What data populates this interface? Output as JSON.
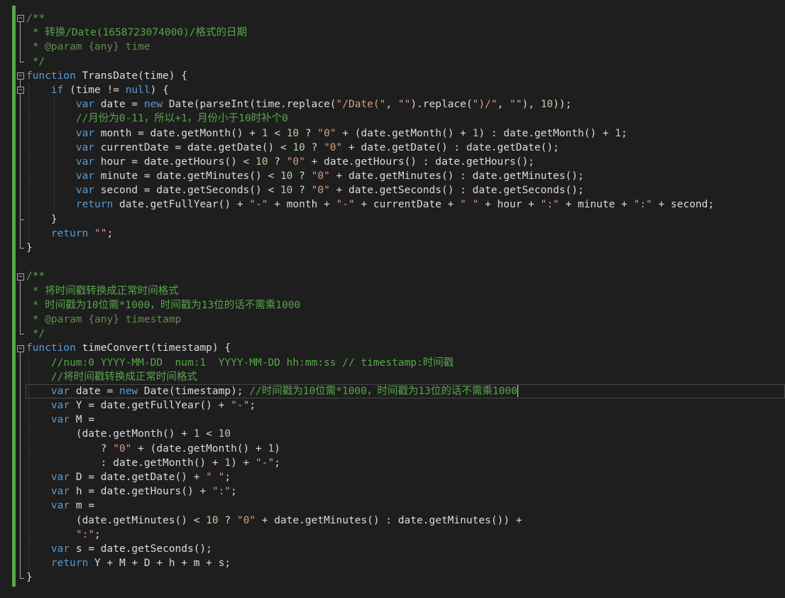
{
  "editor": {
    "colors": {
      "background": "#1e1e1e",
      "comment": "#57a64a",
      "keyword": "#569cd6",
      "string": "#d69d85",
      "number": "#b5cea8",
      "text": "#dcdcdc",
      "change_bar": "#57a64a"
    },
    "lines": [
      [
        [
          "c",
          "/**"
        ]
      ],
      [
        [
          "c",
          " * 转换/Date(1658723074000)/格式的日期"
        ]
      ],
      [
        [
          "c",
          " * "
        ],
        [
          "d",
          "@param"
        ],
        [
          "c",
          " "
        ],
        [
          "d",
          "{any}"
        ],
        [
          "c",
          " "
        ],
        [
          "d",
          "time"
        ]
      ],
      [
        [
          "c",
          " */"
        ]
      ],
      [
        [
          "k",
          "function"
        ],
        [
          "p",
          " TransDate(time) {"
        ]
      ],
      [
        [
          "p",
          "    "
        ],
        [
          "k",
          "if"
        ],
        [
          "p",
          " (time != "
        ],
        [
          "k",
          "null"
        ],
        [
          "p",
          ") {"
        ]
      ],
      [
        [
          "p",
          "        "
        ],
        [
          "k",
          "var"
        ],
        [
          "p",
          " date = "
        ],
        [
          "k",
          "new"
        ],
        [
          "p",
          " Date(parseInt(time.replace("
        ],
        [
          "s",
          "\"/Date(\""
        ],
        [
          "p",
          ", "
        ],
        [
          "s",
          "\"\""
        ],
        [
          "p",
          ").replace("
        ],
        [
          "s",
          "\")/\""
        ],
        [
          "p",
          ", "
        ],
        [
          "s",
          "\"\""
        ],
        [
          "p",
          "), "
        ],
        [
          "n",
          "10"
        ],
        [
          "p",
          "));"
        ]
      ],
      [
        [
          "p",
          "        "
        ],
        [
          "c",
          "//月份为0-11，所以+1，月份小于10时补个0"
        ]
      ],
      [
        [
          "p",
          "        "
        ],
        [
          "k",
          "var"
        ],
        [
          "p",
          " month = date.getMonth() + "
        ],
        [
          "n",
          "1"
        ],
        [
          "p",
          " < "
        ],
        [
          "n",
          "10"
        ],
        [
          "p",
          " ? "
        ],
        [
          "s",
          "\"0\""
        ],
        [
          "p",
          " + (date.getMonth() + "
        ],
        [
          "n",
          "1"
        ],
        [
          "p",
          ") : date.getMonth() + "
        ],
        [
          "n",
          "1"
        ],
        [
          "p",
          ";"
        ]
      ],
      [
        [
          "p",
          "        "
        ],
        [
          "k",
          "var"
        ],
        [
          "p",
          " currentDate = date.getDate() < "
        ],
        [
          "n",
          "10"
        ],
        [
          "p",
          " ? "
        ],
        [
          "s",
          "\"0\""
        ],
        [
          "p",
          " + date.getDate() : date.getDate();"
        ]
      ],
      [
        [
          "p",
          "        "
        ],
        [
          "k",
          "var"
        ],
        [
          "p",
          " hour = date.getHours() < "
        ],
        [
          "n",
          "10"
        ],
        [
          "p",
          " ? "
        ],
        [
          "s",
          "\"0\""
        ],
        [
          "p",
          " + date.getHours() : date.getHours();"
        ]
      ],
      [
        [
          "p",
          "        "
        ],
        [
          "k",
          "var"
        ],
        [
          "p",
          " minute = date.getMinutes() < "
        ],
        [
          "n",
          "10"
        ],
        [
          "p",
          " ? "
        ],
        [
          "s",
          "\"0\""
        ],
        [
          "p",
          " + date.getMinutes() : date.getMinutes();"
        ]
      ],
      [
        [
          "p",
          "        "
        ],
        [
          "k",
          "var"
        ],
        [
          "p",
          " second = date.getSeconds() < "
        ],
        [
          "n",
          "10"
        ],
        [
          "p",
          " ? "
        ],
        [
          "s",
          "\"0\""
        ],
        [
          "p",
          " + date.getSeconds() : date.getSeconds();"
        ]
      ],
      [
        [
          "p",
          "        "
        ],
        [
          "k",
          "return"
        ],
        [
          "p",
          " date.getFullYear() + "
        ],
        [
          "s",
          "\"-\""
        ],
        [
          "p",
          " + month + "
        ],
        [
          "s",
          "\"-\""
        ],
        [
          "p",
          " + currentDate + "
        ],
        [
          "s",
          "\" \""
        ],
        [
          "p",
          " + hour + "
        ],
        [
          "s",
          "\":\""
        ],
        [
          "p",
          " + minute + "
        ],
        [
          "s",
          "\":\""
        ],
        [
          "p",
          " + second;"
        ]
      ],
      [
        [
          "p",
          "    }"
        ]
      ],
      [
        [
          "p",
          "    "
        ],
        [
          "k",
          "return"
        ],
        [
          "p",
          " "
        ],
        [
          "s",
          "\"\""
        ],
        [
          "p",
          ";"
        ]
      ],
      [
        [
          "p",
          "}"
        ]
      ],
      [],
      [
        [
          "c",
          "/**"
        ]
      ],
      [
        [
          "c",
          " * 将时间戳转换成正常时间格式"
        ]
      ],
      [
        [
          "c",
          " * 时间戳为10位需*1000，时间戳为13位的话不需乘1000"
        ]
      ],
      [
        [
          "c",
          " * "
        ],
        [
          "d",
          "@param"
        ],
        [
          "c",
          " "
        ],
        [
          "d",
          "{any}"
        ],
        [
          "c",
          " "
        ],
        [
          "d",
          "timestamp"
        ]
      ],
      [
        [
          "c",
          " */"
        ]
      ],
      [
        [
          "k",
          "function"
        ],
        [
          "p",
          " timeConvert(timestamp) {"
        ]
      ],
      [
        [
          "p",
          "    "
        ],
        [
          "c",
          "//num:0 YYYY-MM-DD  num:1  YYYY-MM-DD hh:mm:ss // timestamp:时间戳"
        ]
      ],
      [
        [
          "p",
          "    "
        ],
        [
          "c",
          "//将时间戳转换成正常时间格式"
        ]
      ],
      [
        [
          "p",
          "    "
        ],
        [
          "k",
          "var"
        ],
        [
          "p",
          " date = "
        ],
        [
          "k",
          "new"
        ],
        [
          "p",
          " Date(timestamp); "
        ],
        [
          "c",
          "//时间戳为10位需*1000，时间戳为13位的话不需乘1000"
        ]
      ],
      [
        [
          "p",
          "    "
        ],
        [
          "k",
          "var"
        ],
        [
          "p",
          " Y = date.getFullYear() + "
        ],
        [
          "s",
          "\"-\""
        ],
        [
          "p",
          ";"
        ]
      ],
      [
        [
          "p",
          "    "
        ],
        [
          "k",
          "var"
        ],
        [
          "p",
          " M ="
        ]
      ],
      [
        [
          "p",
          "        (date.getMonth() + "
        ],
        [
          "n",
          "1"
        ],
        [
          "p",
          " < "
        ],
        [
          "n",
          "10"
        ]
      ],
      [
        [
          "p",
          "            ? "
        ],
        [
          "s",
          "\"0\""
        ],
        [
          "p",
          " + (date.getMonth() + "
        ],
        [
          "n",
          "1"
        ],
        [
          "p",
          ")"
        ]
      ],
      [
        [
          "p",
          "            : date.getMonth() + "
        ],
        [
          "n",
          "1"
        ],
        [
          "p",
          ") + "
        ],
        [
          "s",
          "\"-\""
        ],
        [
          "p",
          ";"
        ]
      ],
      [
        [
          "p",
          "    "
        ],
        [
          "k",
          "var"
        ],
        [
          "p",
          " D = date.getDate() + "
        ],
        [
          "s",
          "\" \""
        ],
        [
          "p",
          ";"
        ]
      ],
      [
        [
          "p",
          "    "
        ],
        [
          "k",
          "var"
        ],
        [
          "p",
          " h = date.getHours() + "
        ],
        [
          "s",
          "\":\""
        ],
        [
          "p",
          ";"
        ]
      ],
      [
        [
          "p",
          "    "
        ],
        [
          "k",
          "var"
        ],
        [
          "p",
          " m ="
        ]
      ],
      [
        [
          "p",
          "        (date.getMinutes() < "
        ],
        [
          "n",
          "10"
        ],
        [
          "p",
          " ? "
        ],
        [
          "s",
          "\"0\""
        ],
        [
          "p",
          " + date.getMinutes() : date.getMinutes()) +"
        ]
      ],
      [
        [
          "p",
          "        "
        ],
        [
          "s",
          "\":\""
        ],
        [
          "p",
          ";"
        ]
      ],
      [
        [
          "p",
          "    "
        ],
        [
          "k",
          "var"
        ],
        [
          "p",
          " s = date.getSeconds();"
        ]
      ],
      [
        [
          "p",
          "    "
        ],
        [
          "k",
          "return"
        ],
        [
          "p",
          " Y + M + D + h + m + s;"
        ]
      ],
      [
        [
          "p",
          "}"
        ]
      ]
    ]
  }
}
